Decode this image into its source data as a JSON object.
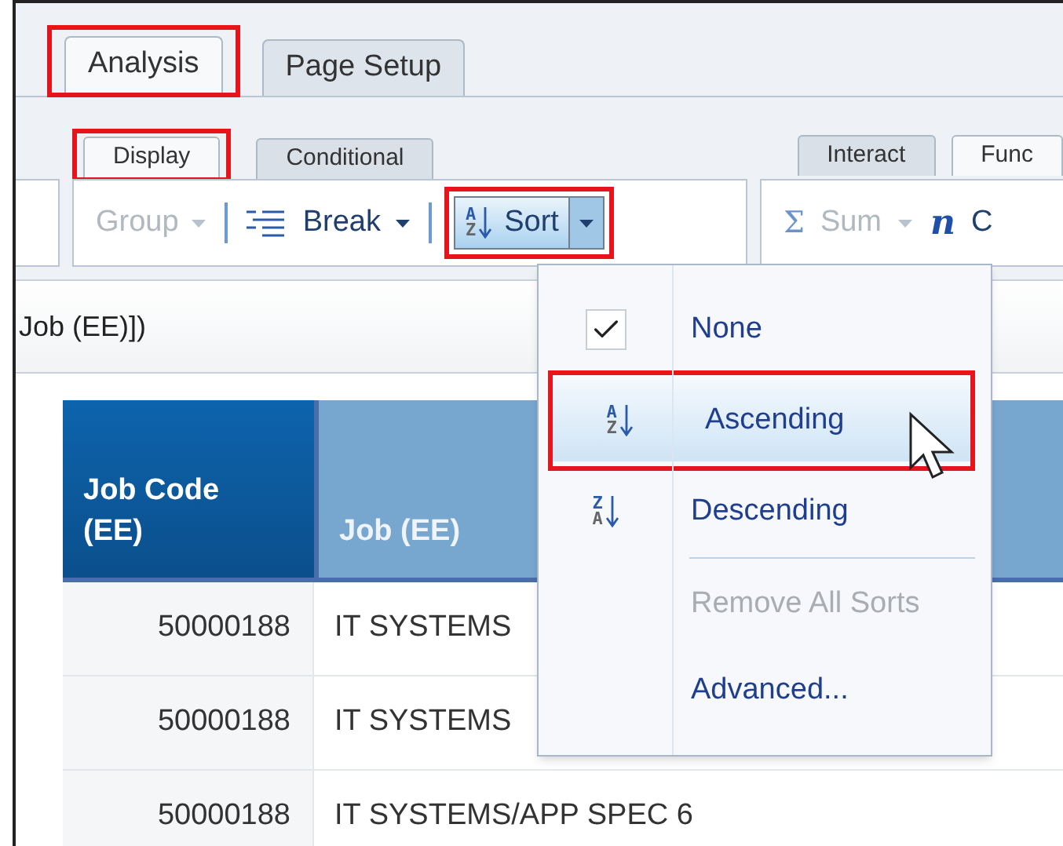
{
  "ribbon_tabs": [
    {
      "label": "Analysis",
      "selected": true,
      "highlighted": true
    },
    {
      "label": "Page Setup",
      "selected": false,
      "highlighted": false
    }
  ],
  "sub_tabs_left": [
    {
      "label": "Display",
      "selected": true,
      "highlighted": true
    },
    {
      "label": "Conditional",
      "selected": false,
      "highlighted": false
    }
  ],
  "sub_tabs_right": [
    {
      "label": "Interact",
      "selected": false
    },
    {
      "label": "Func",
      "selected": true
    }
  ],
  "toolbar": {
    "group": {
      "label": "Group",
      "disabled": true
    },
    "break": {
      "label": "Break",
      "disabled": false
    },
    "sort": {
      "label": "Sort",
      "icon_top": "A",
      "icon_bottom": "Z",
      "open": true,
      "highlighted": true
    },
    "sum": {
      "label": "Sum",
      "icon": "Σ",
      "disabled": true
    },
    "next": {
      "label": "C",
      "icon": "n"
    }
  },
  "formula": "Job (EE)])",
  "table": {
    "columns": [
      {
        "label": "Job Code (EE)",
        "selected": true
      },
      {
        "label": "Job (EE)",
        "selected": false
      }
    ],
    "rows": [
      {
        "code": "50000188",
        "job": "IT SYSTEMS"
      },
      {
        "code": "50000188",
        "job": "IT SYSTEMS"
      },
      {
        "code": "50000188",
        "job": "IT SYSTEMS/APP SPEC 6"
      }
    ]
  },
  "sort_menu": [
    {
      "kind": "check",
      "label": "None",
      "checked": true,
      "hovered": false,
      "highlighted": false,
      "disabled": false
    },
    {
      "kind": "sort",
      "label": "Ascending",
      "icon_top": "A",
      "icon_bottom": "Z",
      "hovered": true,
      "highlighted": true,
      "disabled": false
    },
    {
      "kind": "sort",
      "label": "Descending",
      "icon_top": "Z",
      "icon_bottom": "A",
      "hovered": false,
      "highlighted": false,
      "disabled": false
    },
    {
      "kind": "separator"
    },
    {
      "kind": "plain",
      "label": "Remove All Sorts",
      "hovered": false,
      "highlighted": false,
      "disabled": true
    },
    {
      "kind": "plain",
      "label": "Advanced...",
      "hovered": false,
      "highlighted": false,
      "disabled": false
    }
  ]
}
